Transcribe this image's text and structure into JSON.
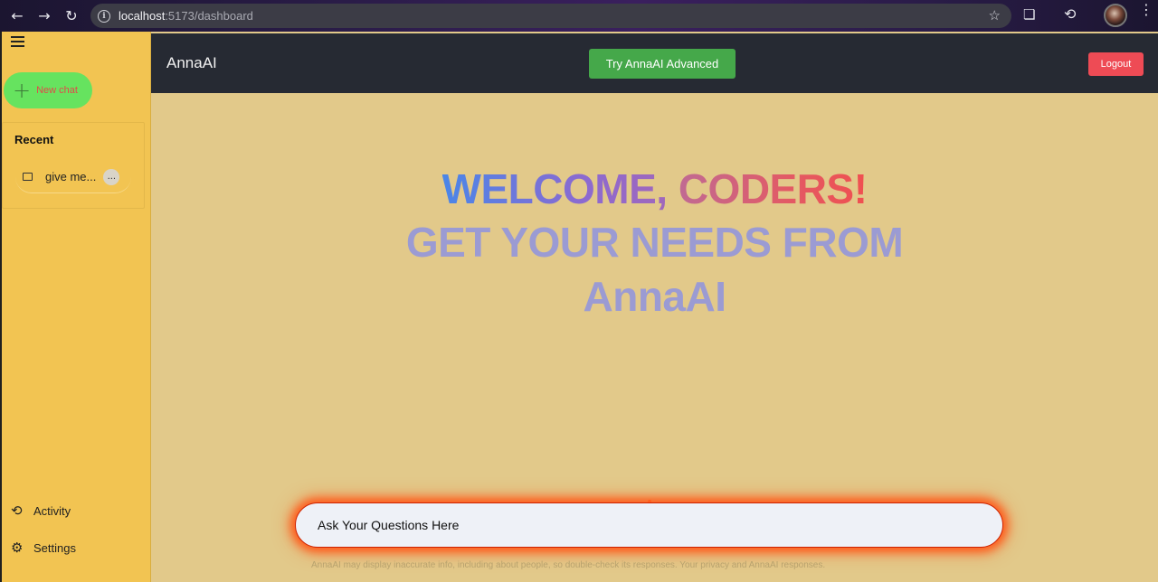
{
  "browser": {
    "url_host": "localhost",
    "url_path": ":5173/dashboard"
  },
  "sidebar": {
    "new_chat_label": "New chat",
    "recent_title": "Recent",
    "recent_items": [
      {
        "label": "give me...",
        "more": "..."
      }
    ],
    "bottom_items": [
      {
        "label": "Activity",
        "icon": "history-icon"
      },
      {
        "label": "Settings",
        "icon": "gear-icon"
      }
    ]
  },
  "header": {
    "brand": "AnnaAI",
    "try_label": "Try AnnaAI Advanced",
    "logout_label": "Logout"
  },
  "hero": {
    "welcome": "WELCOME, ",
    "coders": "CODERS!",
    "line2": "GET YOUR NEEDS FROM",
    "line3": "AnnaAI"
  },
  "input": {
    "placeholder": "Ask Your Questions Here"
  },
  "disclaimer": "AnnaAI may display inaccurate info, including about people, so double-check its responses. Your privacy and AnnaAI responses."
}
